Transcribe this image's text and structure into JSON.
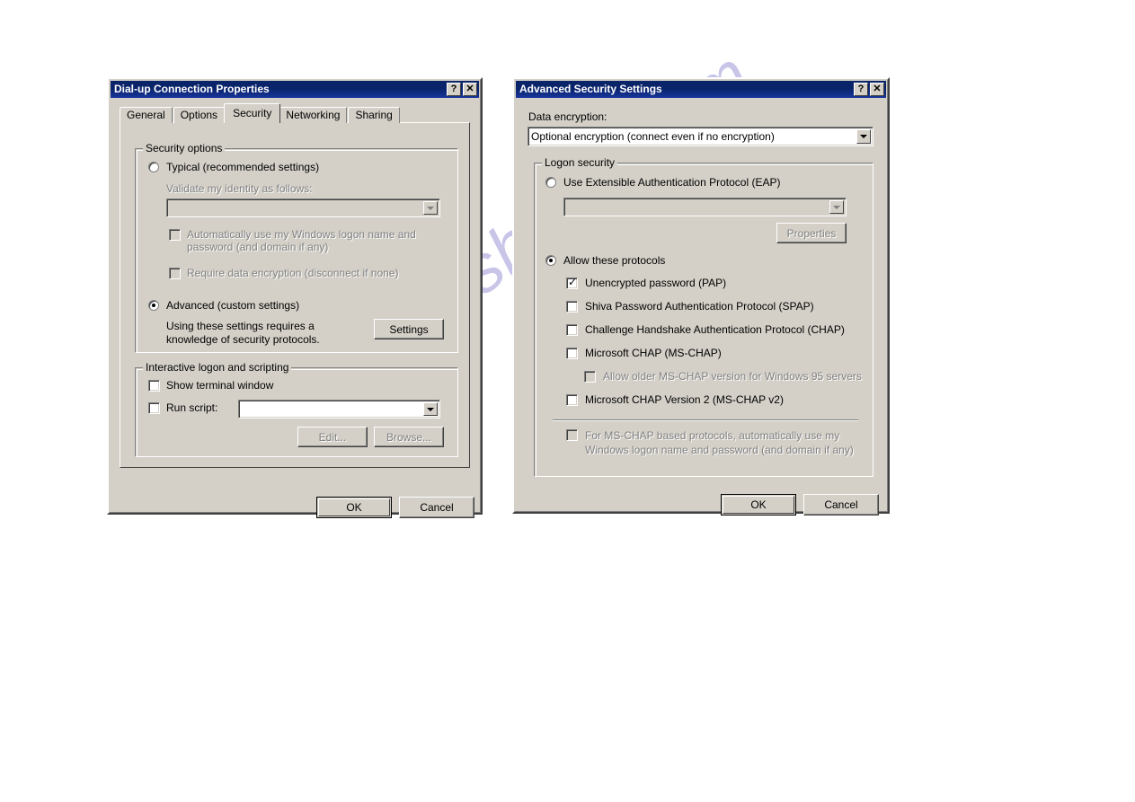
{
  "watermark": {
    "text": "manualshelve.com"
  },
  "dialog1": {
    "title": "Dial-up Connection Properties",
    "titlebar_buttons": [
      {
        "name": "help-button",
        "glyph": "?"
      },
      {
        "name": "close-button",
        "glyph": "✕"
      }
    ],
    "tabs": [
      {
        "label": "General",
        "selected": false
      },
      {
        "label": "Options",
        "selected": false
      },
      {
        "label": "Security",
        "selected": true
      },
      {
        "label": "Networking",
        "selected": false
      },
      {
        "label": "Sharing",
        "selected": false
      }
    ],
    "security_options": {
      "group_title": "Security options",
      "typical_radio": {
        "label": "Typical (recommended settings)",
        "checked": false,
        "disabled": false
      },
      "validate_label": "Validate my identity as follows:",
      "validate_combo": {
        "value": "",
        "disabled": true
      },
      "auto_logon_check": {
        "label": "Automatically use my Windows logon name and password (and domain if any)",
        "checked": false,
        "disabled": true
      },
      "require_encryption_check": {
        "label": "Require data encryption (disconnect if none)",
        "checked": false,
        "disabled": true
      },
      "advanced_radio": {
        "label": "Advanced (custom settings)",
        "checked": true,
        "disabled": false
      },
      "advanced_help_text": "Using these settings requires a knowledge of security protocols.",
      "settings_button": {
        "label": "Settings",
        "disabled": false
      }
    },
    "interactive_logon": {
      "group_title": "Interactive logon and scripting",
      "show_terminal_check": {
        "label": "Show terminal window",
        "checked": false,
        "disabled": false
      },
      "run_script_check": {
        "label": "Run script:",
        "checked": false,
        "disabled": false
      },
      "run_script_combo": {
        "value": "",
        "disabled": false
      },
      "edit_button": {
        "label": "Edit...",
        "disabled": true
      },
      "browse_button": {
        "label": "Browse...",
        "disabled": true
      }
    },
    "ok_button": "OK",
    "cancel_button": "Cancel"
  },
  "dialog2": {
    "title": "Advanced Security Settings",
    "titlebar_buttons": [
      {
        "name": "help-button",
        "glyph": "?"
      },
      {
        "name": "close-button",
        "glyph": "✕"
      }
    ],
    "data_encryption_label": "Data encryption:",
    "data_encryption_combo": {
      "value": "Optional encryption (connect even if no encryption)",
      "disabled": false
    },
    "logon_security": {
      "group_title": "Logon security",
      "eap_radio": {
        "label": "Use Extensible Authentication Protocol (EAP)",
        "checked": false,
        "disabled": false
      },
      "eap_combo": {
        "value": "",
        "disabled": true
      },
      "properties_button": {
        "label": "Properties",
        "disabled": true
      },
      "allow_protocols_radio": {
        "label": "Allow these protocols",
        "checked": true,
        "disabled": false
      },
      "protocols": [
        {
          "label": "Unencrypted password (PAP)",
          "checked": true,
          "disabled": false,
          "indent": 0
        },
        {
          "label": "Shiva Password Authentication Protocol (SPAP)",
          "checked": false,
          "disabled": false,
          "indent": 0
        },
        {
          "label": "Challenge Handshake Authentication Protocol (CHAP)",
          "checked": false,
          "disabled": false,
          "indent": 0
        },
        {
          "label": "Microsoft CHAP (MS-CHAP)",
          "checked": false,
          "disabled": false,
          "indent": 0
        },
        {
          "label": "Allow older MS-CHAP version for Windows 95 servers",
          "checked": false,
          "disabled": true,
          "indent": 1
        },
        {
          "label": "Microsoft CHAP Version 2 (MS-CHAP v2)",
          "checked": false,
          "disabled": false,
          "indent": 0
        }
      ],
      "mschap_auto_check": {
        "label": "For MS-CHAP based protocols, automatically use my Windows logon name and password (and domain if any)",
        "checked": false,
        "disabled": true
      }
    },
    "ok_button": "OK",
    "cancel_button": "Cancel"
  }
}
